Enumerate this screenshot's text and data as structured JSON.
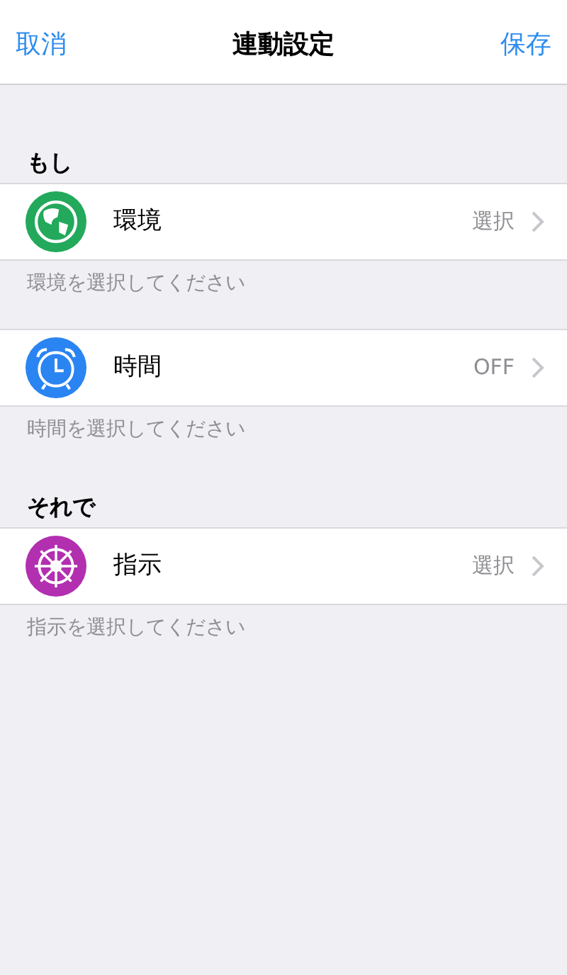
{
  "nav_bar": {
    "cancel": "取消",
    "title": "連動設定",
    "save": "保存"
  },
  "groups": [
    {
      "header": "もし",
      "row": {
        "kind": "globe",
        "label": "環境",
        "value": "選択"
      },
      "footer": "環境を選択してください"
    },
    {
      "row": {
        "kind": "alarm",
        "label": "時間",
        "value": "OFF"
      },
      "footer": "時間を選択してください"
    },
    {
      "header": "それで",
      "row": {
        "kind": "wheel",
        "label": "指示",
        "value": "選択"
      },
      "footer": "指示を選択してください"
    }
  ]
}
